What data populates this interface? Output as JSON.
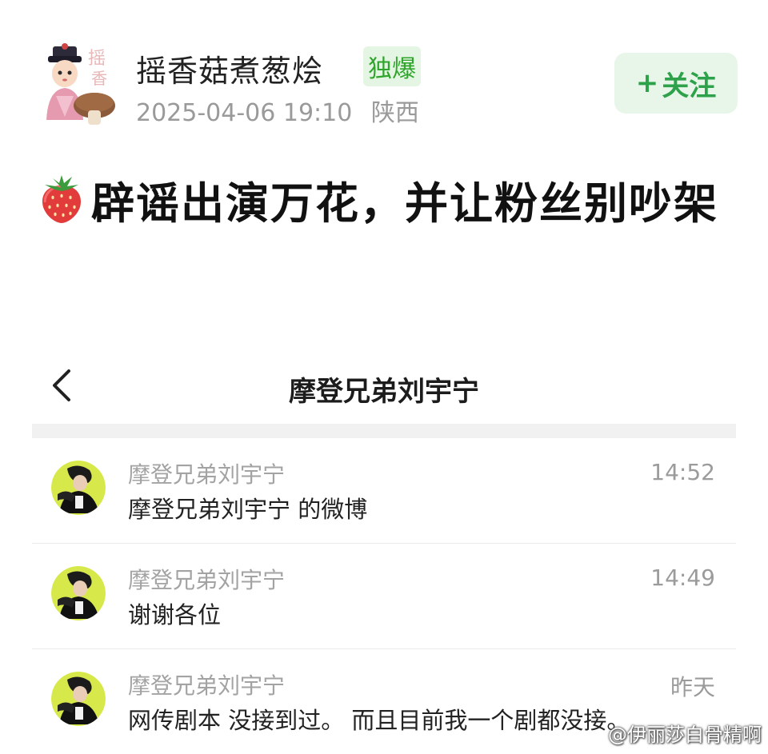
{
  "post": {
    "author_name": "摇香菇煮葱烩",
    "badge": "独爆",
    "date": "2025-04-06 19:10",
    "location": "陕西",
    "follow_label": "关注",
    "follow_plus": "+",
    "title": "辟谣出演万花，并让粉丝别吵架",
    "title_icon": "strawberry-icon"
  },
  "chat": {
    "back_icon": "chevron-left-icon",
    "title": "摩登兄弟刘宇宁",
    "messages": [
      {
        "sender": "摩登兄弟刘宇宁",
        "time": "14:52",
        "text": "摩登兄弟刘宇宁 的微博"
      },
      {
        "sender": "摩登兄弟刘宇宁",
        "time": "14:49",
        "text": "谢谢各位"
      },
      {
        "sender": "摩登兄弟刘宇宁",
        "time": "昨天",
        "text": "网传剧本 没接到过。 而且目前我一个剧都没接。"
      }
    ]
  },
  "watermark": "@伊丽莎白骨精啊",
  "colors": {
    "badge_bg": "#e5f5e3",
    "badge_text": "#2fa52b",
    "follow_bg": "#e7f6e8",
    "follow_text": "#2da24a",
    "avatar_ring": "#d7e84a"
  }
}
